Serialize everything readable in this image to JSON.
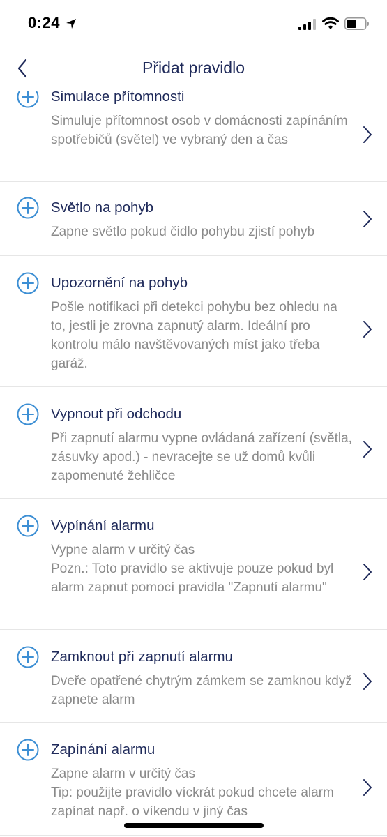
{
  "status_bar": {
    "time": "0:24",
    "icons": [
      "location-arrow-icon",
      "cellular-signal-icon",
      "wifi-icon",
      "battery-icon"
    ]
  },
  "header": {
    "title": "Přidat pravidlo",
    "back_icon": "chevron-left-icon"
  },
  "rules": [
    {
      "title": "Simulace přítomnosti",
      "description": "Simuluje přítomnost osob v domácnosti zapínáním spotřebičů (světel) ve vybraný den a čas"
    },
    {
      "title": "Světlo na pohyb",
      "description": "Zapne světlo pokud čidlo pohybu zjistí pohyb"
    },
    {
      "title": "Upozornění na pohyb",
      "description": "Pošle notifikaci při detekci pohybu bez ohledu na to, jestli je zrovna zapnutý alarm. Ideální pro kontrolu málo navštěvovaných míst jako třeba garáž."
    },
    {
      "title": "Vypnout při odchodu",
      "description": "Při zapnutí alarmu vypne ovládaná zařízení (světla, zásuvky apod.) - nevracejte se už domů kvůli zapomenuté žehličce"
    },
    {
      "title": "Vypínání alarmu",
      "description": "Vypne alarm v určitý čas\nPozn.: Toto pravidlo se aktivuje pouze pokud byl alarm zapnut pomocí pravidla \"Zapnutí alarmu\""
    },
    {
      "title": "Zamknout při zapnutí alarmu",
      "description": "Dveře opatřené chytrým zámkem se zamknou když zapnete alarm"
    },
    {
      "title": "Zapínání alarmu",
      "description": "Zapne alarm v určitý čas\nTip: použijte pravidlo víckrát pokud chcete alarm zapínat např. o víkendu v jiný čas"
    }
  ],
  "colors": {
    "accent": "#3d8fd4",
    "title_text": "#1f2a5a",
    "description_text": "#8a8a8a",
    "divider": "#e6e6e6"
  }
}
